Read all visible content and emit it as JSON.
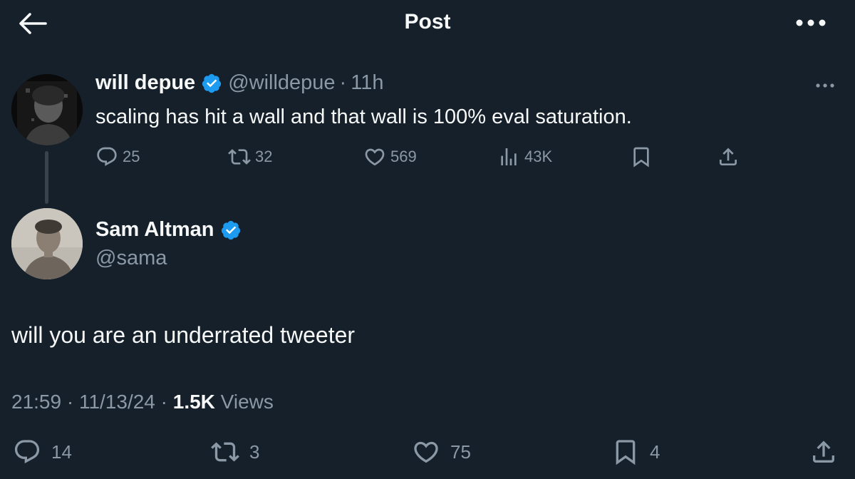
{
  "header": {
    "title": "Post"
  },
  "parent_tweet": {
    "name": "will depue",
    "handle": "@willdepue",
    "separator": "·",
    "time": "11h",
    "text": "scaling has hit a wall and that wall is 100% eval saturation.",
    "replies": "25",
    "reposts": "32",
    "likes": "569",
    "views": "43K"
  },
  "reply_tweet": {
    "name": "Sam Altman",
    "handle": "@sama",
    "text": "will you are an underrated tweeter",
    "timestamp": "21:59 · 11/13/24 · ",
    "views_count": "1.5K",
    "views_label": " Views",
    "replies": "14",
    "reposts": "3",
    "likes": "75",
    "bookmarks": "4"
  },
  "colors": {
    "background": "#15202b",
    "text_primary": "#f7f9f9",
    "text_secondary": "#8b98a5",
    "verified": "#1d9bf0"
  },
  "icons": [
    "back-arrow-icon",
    "more-icon",
    "verified-badge-icon",
    "reply-icon",
    "repost-icon",
    "like-icon",
    "views-icon",
    "bookmark-icon",
    "share-icon"
  ]
}
